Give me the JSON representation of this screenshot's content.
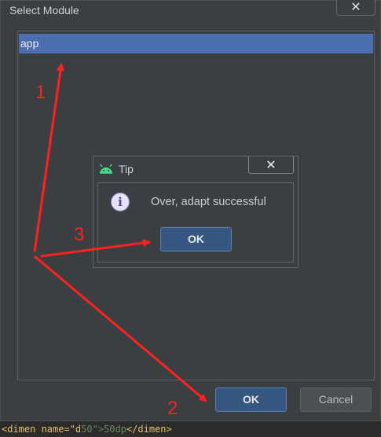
{
  "dialog": {
    "title": "Select Module",
    "close_label": "✕",
    "modules": [
      "app"
    ],
    "ok_label": "OK",
    "cancel_label": "Cancel"
  },
  "tip": {
    "title": "Tip",
    "close_label": "✕",
    "message": "Over, adapt successful",
    "icon": "info-icon",
    "icon_glyph": "i",
    "ok_label": "OK"
  },
  "annotations": {
    "step1": "1",
    "step2": "2",
    "step3": "3",
    "color": "#ff2020"
  },
  "background_code": {
    "line_prefix": "<dimen name=\"d",
    "line_mid": "50\">50dp",
    "line_suffix": "</dimen>"
  },
  "colors": {
    "selection": "#4b6eaf",
    "default_button": "#365880",
    "dialog_bg": "#3c3f41"
  }
}
